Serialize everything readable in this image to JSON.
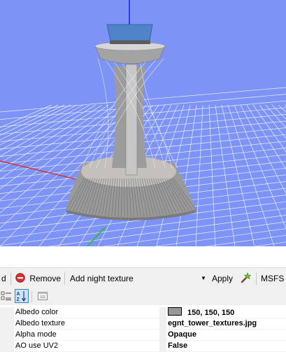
{
  "viewport": {
    "sky_color": "#7d93f5",
    "ground_color": "#7a90f1",
    "grid_color": "#ffffff",
    "x_axis_color": "#e02020",
    "y_axis_color": "#1a1aff",
    "z_axis_color": "#16c916",
    "model_color": "#c8c8c8",
    "cab_color": "#4f84c8"
  },
  "toolbar": {
    "cut_label": "d",
    "remove_label": "Remove",
    "dropdown_value": "Add night texture",
    "apply_label": "Apply",
    "msfs_label": "MSFS"
  },
  "properties": [
    {
      "name": "Albedo color",
      "value": "150, 150, 150",
      "swatch": "#969696"
    },
    {
      "name": "Albedo texture",
      "value": "egnt_tower_textures.jpg"
    },
    {
      "name": "Alpha mode",
      "value": "Opaque"
    },
    {
      "name": "AO use UV2",
      "value": "False"
    }
  ]
}
